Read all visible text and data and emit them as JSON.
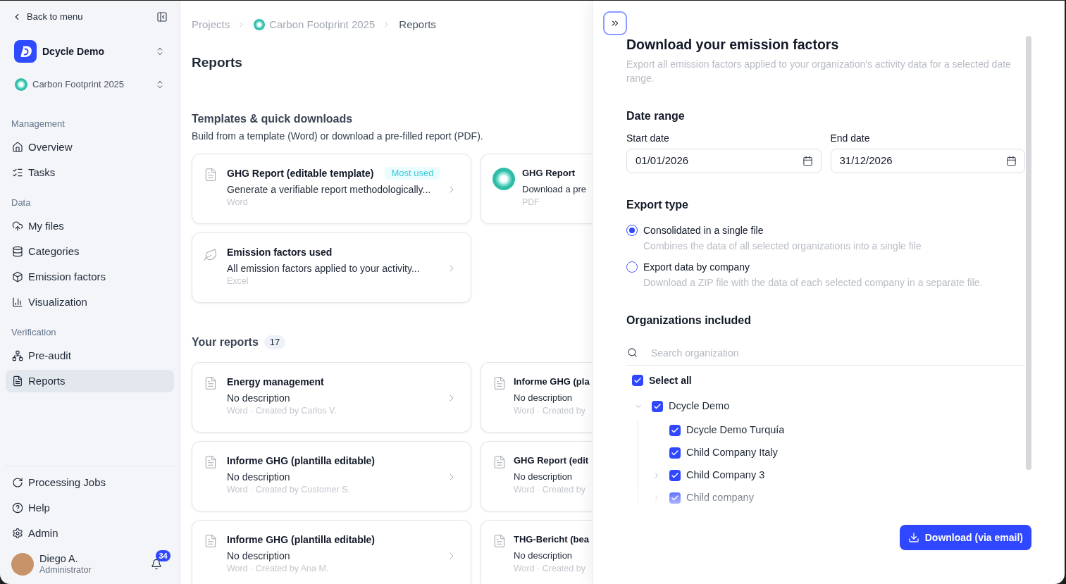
{
  "sidebar": {
    "back_link": "Back to menu",
    "organization": "Dcycle Demo",
    "project": "Carbon Footprint 2025",
    "sections": [
      {
        "title": "Management",
        "items": [
          {
            "label": "Overview",
            "selected": false
          },
          {
            "label": "Tasks",
            "selected": false
          }
        ]
      },
      {
        "title": "Data",
        "items": [
          {
            "label": "My files",
            "selected": false
          },
          {
            "label": "Categories",
            "selected": false
          },
          {
            "label": "Emission factors",
            "selected": false
          },
          {
            "label": "Visualization",
            "selected": false
          }
        ]
      },
      {
        "title": "Verification",
        "items": [
          {
            "label": "Pre-audit",
            "selected": false
          },
          {
            "label": "Reports",
            "selected": true
          }
        ]
      }
    ],
    "footer_items": [
      {
        "label": "Processing Jobs",
        "selected": false
      },
      {
        "label": "Help",
        "selected": false
      },
      {
        "label": "Admin",
        "selected": false
      }
    ],
    "user": {
      "name": "Diego A.",
      "role": "Administrator",
      "notifications": "34"
    }
  },
  "breadcrumb": [
    {
      "label": "Projects",
      "kind": "link"
    },
    {
      "label": "Carbon Footprint 2025",
      "kind": "project"
    },
    {
      "label": "Reports",
      "kind": "current"
    }
  ],
  "page_title": "Reports",
  "templates": {
    "title": "Templates & quick downloads",
    "subtitle": "Build from a template (Word) or download a pre-filled report (PDF).",
    "cards": [
      {
        "kind": "document",
        "title": "GHG Report (editable template)",
        "badge": "Most used",
        "description": "Generate a verifiable report methodologically...",
        "format": "Word"
      },
      {
        "kind": "project",
        "title": "GHG Report",
        "description": "Download a pre",
        "format": "PDF"
      },
      {
        "kind": "factors",
        "title": "Emission factors used",
        "description": "All emission factors applied to your activity...",
        "format": "Excel"
      }
    ]
  },
  "reports": {
    "title": "Your reports",
    "count": "17",
    "cards": [
      {
        "title": "Energy management",
        "description": "No description",
        "meta": "Word · Created by Carlos V."
      },
      {
        "title": "Informe GHG (pla",
        "description": "No description",
        "meta": "Word · Created by"
      },
      {
        "title": "Informe GHG (plantilla editable)",
        "description": "No description",
        "meta": "Word · Created by Customer S."
      },
      {
        "title": "GHG Report (edit",
        "description": "No description",
        "meta": "Word · Created by"
      },
      {
        "title": "Informe GHG (plantilla editable)",
        "description": "No description",
        "meta": "Word · Created by Ana M."
      },
      {
        "title": "THG-Bericht (bea",
        "description": "No description",
        "meta": "Word · Created by"
      }
    ]
  },
  "drawer": {
    "title": "Download your emission factors",
    "description": "Export all emission factors applied to your organization's activity data for a selected date range.",
    "date_range": {
      "title": "Date range",
      "fields": [
        {
          "label": "Start date",
          "value": "01/01/2026"
        },
        {
          "label": "End date",
          "value": "31/12/2026"
        }
      ]
    },
    "export_type": {
      "title": "Export type",
      "options": [
        {
          "label": "Consolidated in a single file",
          "description": "Combines the data of all selected organizations into a single file",
          "selected": true
        },
        {
          "label": "Export data by company",
          "description": "Download a ZIP file with the data of each selected company in a separate file.",
          "selected": false
        }
      ]
    },
    "organizations": {
      "title": "Organizations included",
      "search": {
        "placeholder": "Search organization"
      },
      "select_all": {
        "label": "Select all",
        "checked": true
      },
      "tree": [
        {
          "name": "Dcycle Demo",
          "kind": "group",
          "expanded": true,
          "checked": true,
          "children": [
            {
              "name": "Dcycle Demo Turquía",
              "kind": "item",
              "checked": true
            },
            {
              "name": "Child Company Italy",
              "kind": "item",
              "checked": true
            },
            {
              "name": "Child Company 3",
              "kind": "group",
              "expanded": false,
              "checked": true
            },
            {
              "name": "Child company",
              "kind": "group",
              "expanded": false,
              "checked": true
            }
          ]
        }
      ]
    },
    "download_button": "Download (via email)"
  }
}
